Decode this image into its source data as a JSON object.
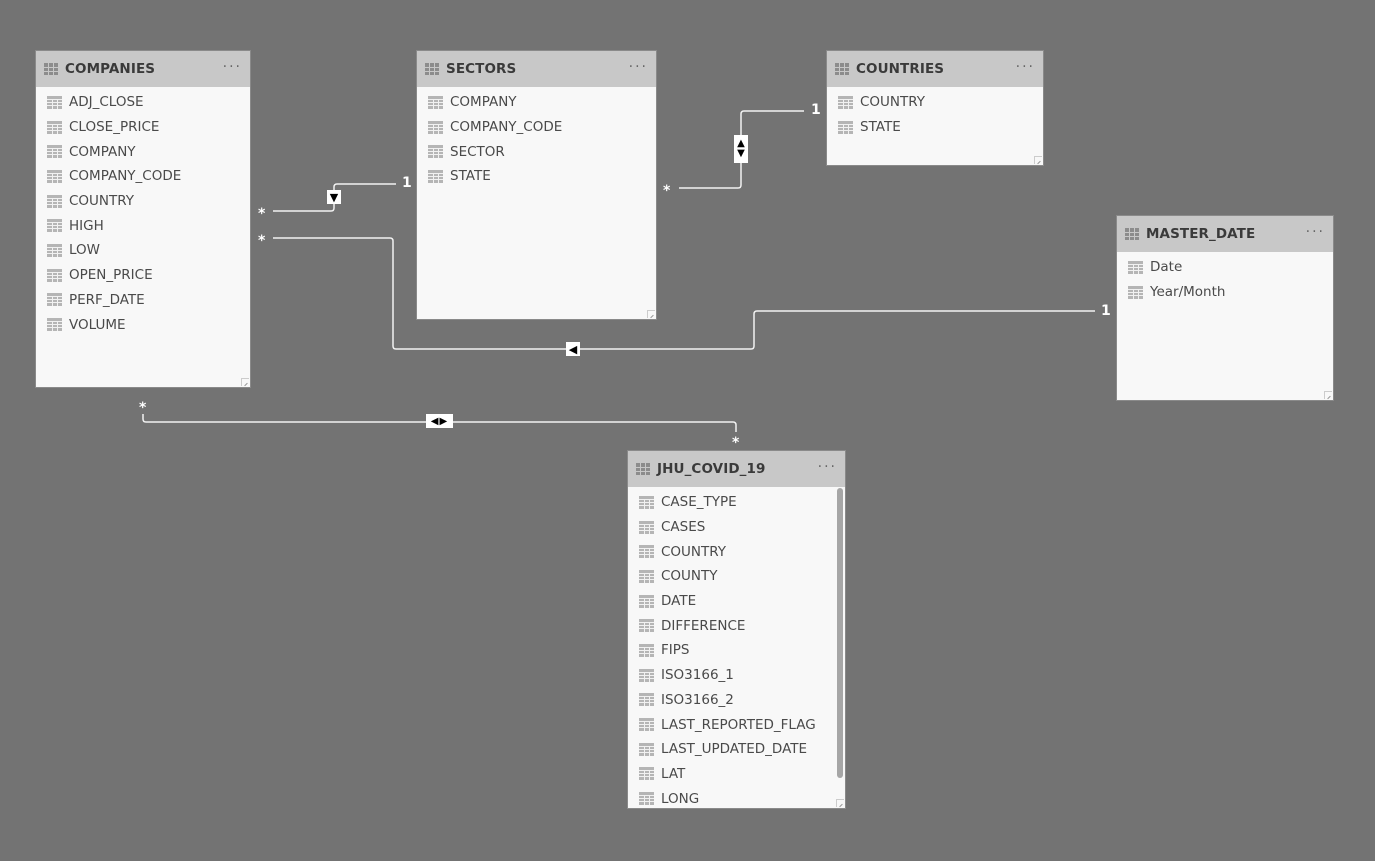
{
  "tables": [
    {
      "id": "companies",
      "title": "COMPANIES",
      "more_label": "···",
      "fields": [
        "ADJ_CLOSE",
        "CLOSE_PRICE",
        "COMPANY",
        "COMPANY_CODE",
        "COUNTRY",
        "HIGH",
        "LOW",
        "OPEN_PRICE",
        "PERF_DATE",
        "VOLUME"
      ]
    },
    {
      "id": "sectors",
      "title": "SECTORS",
      "more_label": "···",
      "fields": [
        "COMPANY",
        "COMPANY_CODE",
        "SECTOR",
        "STATE"
      ]
    },
    {
      "id": "countries",
      "title": "COUNTRIES",
      "more_label": "···",
      "fields": [
        "COUNTRY",
        "STATE"
      ]
    },
    {
      "id": "master_date",
      "title": "MASTER_DATE",
      "more_label": "···",
      "fields": [
        "Date",
        "Year/Month"
      ]
    },
    {
      "id": "jhu_covid_19",
      "title": "JHU_COVID_19",
      "more_label": "···",
      "fields": [
        "CASE_TYPE",
        "CASES",
        "COUNTRY",
        "COUNTY",
        "DATE",
        "DIFFERENCE",
        "FIPS",
        "ISO3166_1",
        "ISO3166_2",
        "LAST_REPORTED_FLAG",
        "LAST_UPDATED_DATE",
        "LAT",
        "LONG"
      ]
    }
  ],
  "relationships": [
    {
      "from": "COMPANIES",
      "to": "SECTORS",
      "from_cardinality": "*",
      "to_cardinality": "1",
      "cross_filter": "single",
      "direction_glyph": "▼"
    },
    {
      "from": "SECTORS",
      "to": "COUNTRIES",
      "from_cardinality": "*",
      "to_cardinality": "1",
      "cross_filter": "both",
      "direction_glyph": "▲▼"
    },
    {
      "from": "COMPANIES",
      "to": "MASTER_DATE",
      "from_cardinality": "*",
      "to_cardinality": "1",
      "cross_filter": "single",
      "direction_glyph": "◀"
    },
    {
      "from": "COMPANIES",
      "to": "JHU_COVID_19",
      "from_cardinality": "*",
      "to_cardinality": "*",
      "cross_filter": "both",
      "direction_glyph": "◀▶"
    }
  ],
  "colors": {
    "canvas": "#737373",
    "card_header": "#c8c8c8",
    "card_body": "#f8f8f8",
    "line": "#f2f2f2"
  }
}
